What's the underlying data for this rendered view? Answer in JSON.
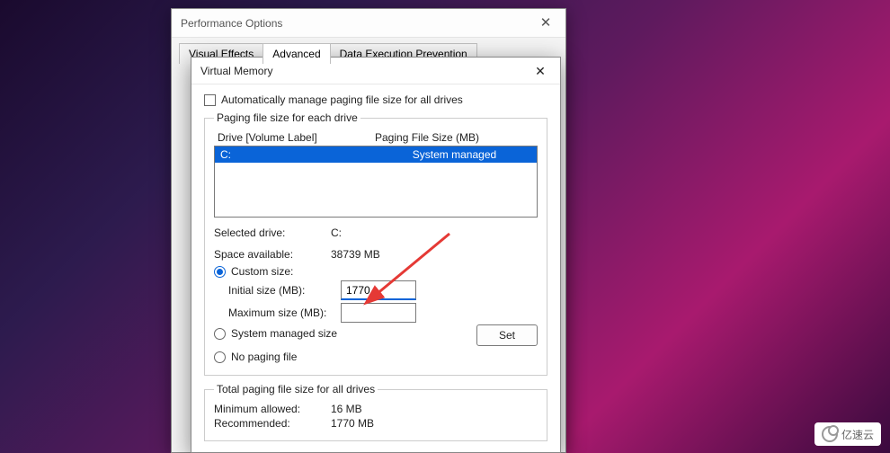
{
  "parent": {
    "title": "Performance Options",
    "tabs": [
      "Visual Effects",
      "Advanced",
      "Data Execution Prevention"
    ],
    "active_tab": 1
  },
  "dialog": {
    "title": "Virtual Memory",
    "auto_manage": "Automatically manage paging file size for all drives",
    "group1_legend": "Paging file size for each drive",
    "col_drive": "Drive  [Volume Label]",
    "col_size": "Paging File Size (MB)",
    "drive_row": {
      "drive": "C:",
      "size": "System managed"
    },
    "selected_drive_label": "Selected drive:",
    "selected_drive": "C:",
    "space_label": "Space available:",
    "space": "38739 MB",
    "custom": "Custom size:",
    "initial_label": "Initial size (MB):",
    "initial_value": "1770",
    "max_label": "Maximum size (MB):",
    "max_value": "",
    "system_managed": "System managed size",
    "no_paging": "No paging file",
    "set": "Set",
    "total_legend": "Total paging file size for all drives",
    "min_label": "Minimum allowed:",
    "min": "16 MB",
    "rec_label": "Recommended:",
    "rec": "1770 MB"
  },
  "watermark": "亿速云"
}
